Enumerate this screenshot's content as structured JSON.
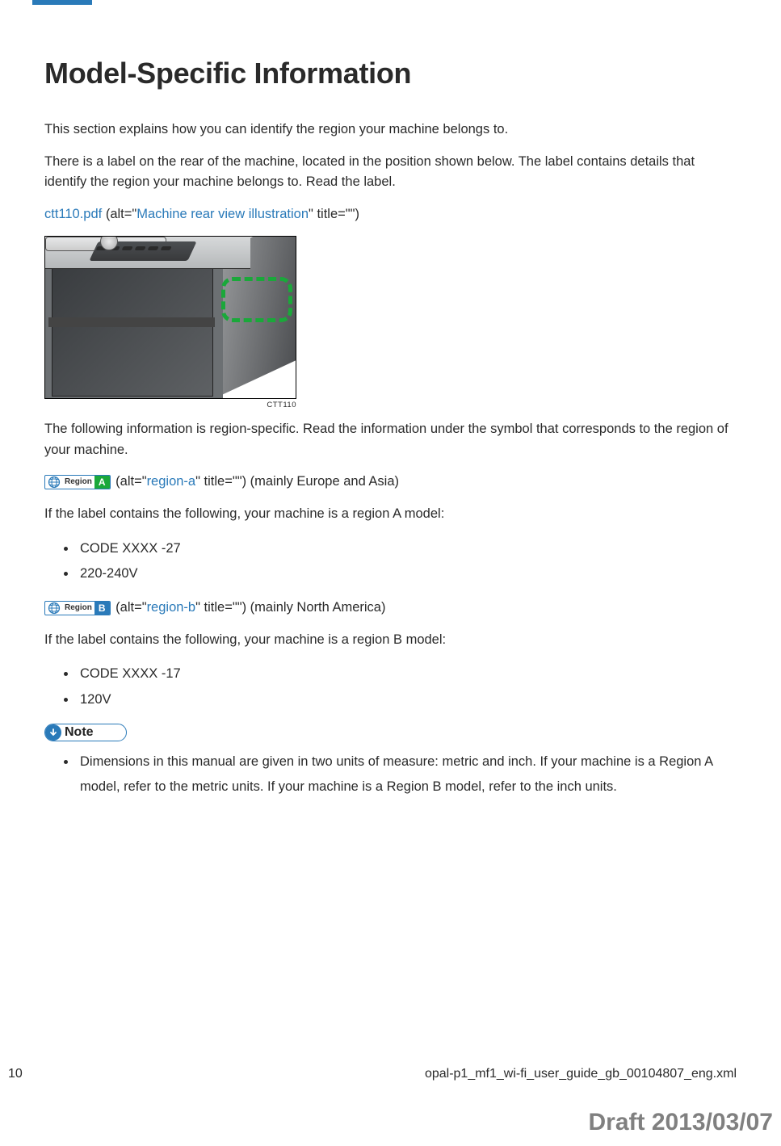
{
  "heading": "Model-Specific Information",
  "para1": "This section explains how you can identify the region your machine belongs to.",
  "para2": "There is a label on the rear of the machine, located in the position shown below. The label contains details that identify the region your machine belongs to. Read the label.",
  "img_ref": {
    "filename": "ctt110.pdf",
    "alt_prefix": " (alt=\"",
    "alt_text": "Machine rear view illustration",
    "alt_suffix": "\" title=\"\")"
  },
  "fig_caption": "CTT110",
  "para3": "The following information is region-specific. Read the information under the symbol that corresponds to the region of your machine.",
  "region_a": {
    "badge_text": "Region",
    "badge_letter": "A",
    "alt_prefix": " (alt=\"",
    "alt_text": "region-a",
    "alt_suffix": "\" title=\"\")",
    "region_desc": " (mainly Europe and Asia)",
    "intro": "If the label contains the following, your machine is a region A model:",
    "items": [
      "CODE XXXX -27",
      "220-240V"
    ]
  },
  "region_b": {
    "badge_text": "Region",
    "badge_letter": "B",
    "alt_prefix": " (alt=\"",
    "alt_text": "region-b",
    "alt_suffix": "\" title=\"\")",
    "region_desc": " (mainly North America)",
    "intro": "If the label contains the following, your machine is a region B model:",
    "items": [
      "CODE XXXX -17",
      "120V"
    ]
  },
  "note": {
    "label": "Note",
    "items": [
      "Dimensions in this manual are given in two units of measure: metric and inch. If your machine is a Region A model, refer to the metric units. If your machine is a Region B model, refer to the inch units."
    ]
  },
  "footer": {
    "page_number": "10",
    "filename": "opal-p1_mf1_wi-fi_user_guide_gb_00104807_eng.xml"
  },
  "draft_stamp": "Draft 2013/03/07"
}
